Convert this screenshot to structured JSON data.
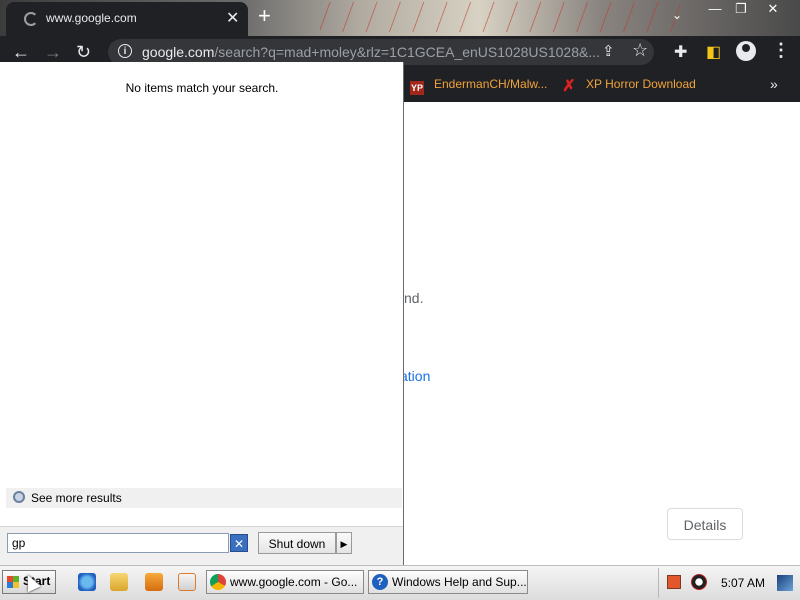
{
  "browser": {
    "tab": {
      "title": "www.google.com"
    },
    "window_controls": {
      "minimize": "—",
      "restore": "❐",
      "close": "✕"
    },
    "toolbar": {
      "url_host": "google.com",
      "url_path": "/search?q=mad+moley&rlz=1C1GCEA_enUS1028US1028&..."
    },
    "bookmarks": [
      {
        "label": "EndermanCH/Malw...",
        "icon": "yp-icon"
      },
      {
        "label": "XP Horror Download",
        "icon": "x-icon"
      }
    ]
  },
  "page": {
    "fragment1": "nd.",
    "fragment2": "ation",
    "details_button": "Details"
  },
  "start_menu": {
    "no_items": "No items match your search.",
    "see_more": "See more results",
    "search_value": "gp",
    "shutdown_label": "Shut down"
  },
  "taskbar": {
    "start_label": "Start",
    "items": [
      {
        "label": "www.google.com - Go..."
      },
      {
        "label": "Windows Help and Sup..."
      }
    ],
    "clock": "5:07 AM"
  },
  "colors": {
    "chrome_dark": "#202124",
    "bookmark_text": "#f0a33a",
    "link_blue": "#1a73e8"
  }
}
